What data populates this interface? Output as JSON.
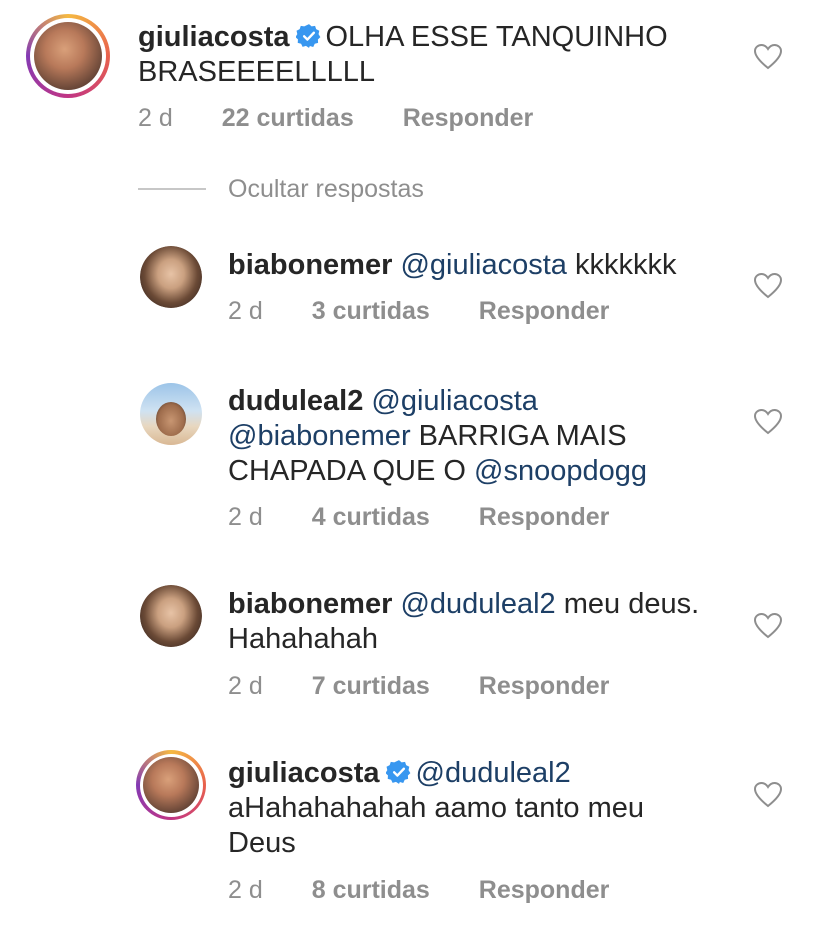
{
  "icons": {
    "verified": "verified-badge-icon",
    "heart": "heart-outline-icon"
  },
  "colors": {
    "mention": "#1d3f66",
    "meta": "#8e8e8e",
    "verified_blue": "#3897f0"
  },
  "comments": [
    {
      "username": "giuliacosta",
      "verified": true,
      "line1": "OLHA ESSE TANQUINHO",
      "line2": "BRASEEEELLLLL",
      "time": "2 d",
      "likes": "22 curtidas",
      "reply": "Responder"
    },
    {
      "username": "biabonemer",
      "mention1": "@giuliacosta",
      "text": "kkkkkkk",
      "time": "2 d",
      "likes": "3 curtidas",
      "reply": "Responder"
    },
    {
      "username": "duduleal2",
      "mention1": "@giuliacosta",
      "mention2": "@biabonemer",
      "text_mid": "BARRIGA MAIS",
      "text_pre": "CHAPADA QUE O",
      "mention3": "@snoopdogg",
      "time": "2 d",
      "likes": "4 curtidas",
      "reply": "Responder"
    },
    {
      "username": "biabonemer",
      "mention1": "@duduleal2",
      "text": "meu deus.",
      "line2": "Hahahahah",
      "time": "2 d",
      "likes": "7 curtidas",
      "reply": "Responder"
    },
    {
      "username": "giuliacosta",
      "verified": true,
      "mention1": "@duduleal2",
      "line2": "aHahahahahah aamo tanto meu",
      "line3": "Deus",
      "time": "2 d",
      "likes": "8 curtidas",
      "reply": "Responder"
    }
  ],
  "hide_replies_label": "Ocultar respostas"
}
